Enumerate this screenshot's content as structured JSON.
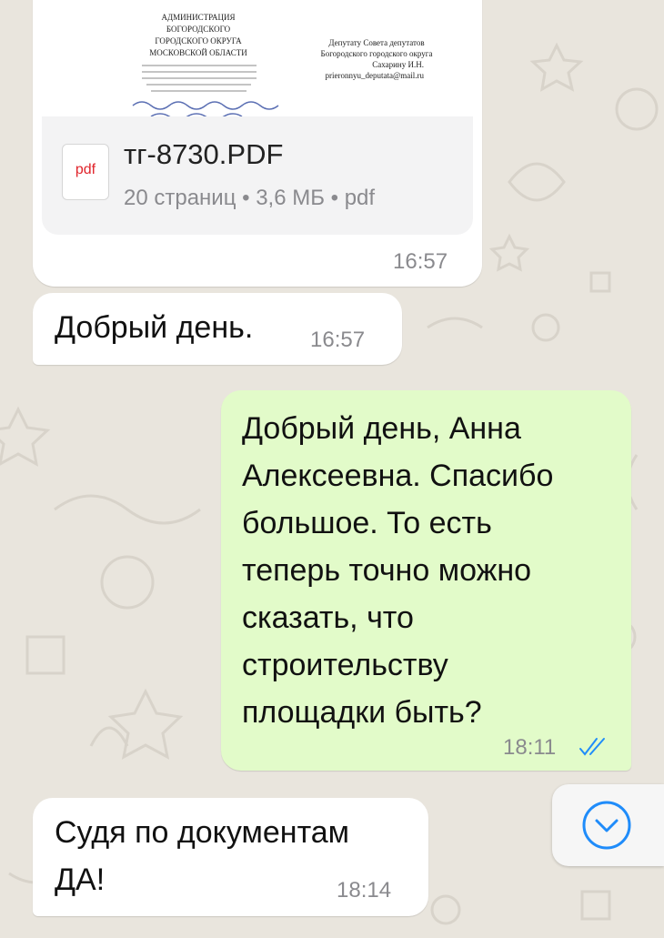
{
  "document_message": {
    "letter_left_lines": [
      "АДМИНИСТРАЦИЯ",
      "БОГОРОДСКОГО",
      "ГОРОДСКОГО ОКРУГА",
      "МОСКОВСКОЙ ОБЛАСТИ"
    ],
    "letter_right_lines": [
      "Депутату Совета депутатов",
      "Богородского городского округа",
      "Сахарину И.Н.",
      "prieronnyu_deputata@mail.ru"
    ],
    "file_name": "тг-8730.PDF",
    "file_meta": "20 страниц • 3,6 МБ • pdf",
    "file_icon_label": "pdf",
    "time": "16:57"
  },
  "messages": [
    {
      "direction": "incoming",
      "text_lines": [
        "Добрый день."
      ],
      "time": "16:57"
    },
    {
      "direction": "outgoing",
      "text_lines": [
        "Добрый день, Анна",
        "Алексеевна. Спасибо",
        "большое. То есть",
        "теперь точно можно",
        "сказать, что",
        "строительству",
        "площадки быть?"
      ],
      "time": "18:11",
      "status": "read-double-check"
    },
    {
      "direction": "incoming",
      "text_lines": [
        "Судя по документам",
        "ДА!"
      ],
      "time": "18:14"
    }
  ],
  "scroll_button": {
    "icon": "chevron-down-icon"
  },
  "colors": {
    "background": "#e9e5dd",
    "incoming_bubble": "#ffffff",
    "outgoing_bubble": "#e2fbc9",
    "accent_blue": "#1f8cfa",
    "pdf_red": "#e0242b",
    "meta_gray": "#8a8a8e"
  }
}
